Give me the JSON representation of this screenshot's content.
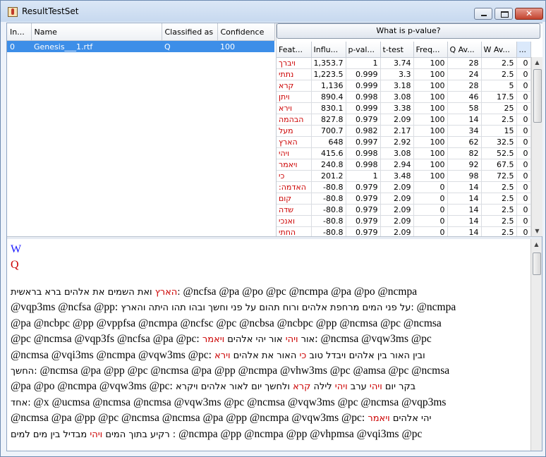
{
  "window": {
    "title": "ResultTestSet"
  },
  "results_table": {
    "columns": [
      "In...",
      "Name",
      "Classified as",
      "Confidence"
    ],
    "rows": [
      {
        "index": "0",
        "name": "Genesis___1.rtf",
        "class": "Q",
        "confidence": "100"
      }
    ]
  },
  "pvalue_button": "What is p-value?",
  "feature_table": {
    "columns": [
      "Feat...",
      "Influ...",
      "p-val...",
      "t-test",
      "Freq...",
      "Q Av...",
      "W Av...",
      "..."
    ],
    "rows": [
      [
        "ויברך",
        "1,353.7",
        "1",
        "3.74",
        "100",
        "28",
        "2.5",
        "0"
      ],
      [
        "נתתי",
        "1,223.5",
        "0.999",
        "3.3",
        "100",
        "24",
        "2.5",
        "0"
      ],
      [
        "קרא",
        "1,136",
        "0.999",
        "3.18",
        "100",
        "28",
        "5",
        "0"
      ],
      [
        "ויתן",
        "890.4",
        "0.998",
        "3.08",
        "100",
        "46",
        "17.5",
        "0"
      ],
      [
        "וירא",
        "830.1",
        "0.999",
        "3.38",
        "100",
        "58",
        "25",
        "0"
      ],
      [
        "הבהמה",
        "827.8",
        "0.979",
        "2.09",
        "100",
        "14",
        "2.5",
        "0"
      ],
      [
        "מעל",
        "700.7",
        "0.982",
        "2.17",
        "100",
        "34",
        "15",
        "0"
      ],
      [
        "הארץ",
        "648",
        "0.997",
        "2.92",
        "100",
        "62",
        "32.5",
        "0"
      ],
      [
        "ויהי",
        "415.6",
        "0.998",
        "3.08",
        "100",
        "82",
        "52.5",
        "0"
      ],
      [
        "ויאמר",
        "240.8",
        "0.998",
        "2.94",
        "100",
        "92",
        "67.5",
        "0"
      ],
      [
        "כי",
        "201.2",
        "1",
        "3.48",
        "100",
        "98",
        "72.5",
        "0"
      ],
      [
        "האדמה:",
        "-80.8",
        "0.979",
        "2.09",
        "0",
        "14",
        "2.5",
        "0"
      ],
      [
        "קום",
        "-80.8",
        "0.979",
        "2.09",
        "0",
        "14",
        "2.5",
        "0"
      ],
      [
        "שדה",
        "-80.8",
        "0.979",
        "2.09",
        "0",
        "14",
        "2.5",
        "0"
      ],
      [
        "ואנכי",
        "-80.8",
        "0.979",
        "2.09",
        "0",
        "14",
        "2.5",
        "0"
      ],
      [
        "החתי",
        "-80.8",
        "0.979",
        "2.09",
        "0",
        "14",
        "2.5",
        "0"
      ]
    ]
  },
  "text_pane": {
    "class_w": "W",
    "class_q": "Q",
    "lines": [
      [
        [
          "r",
          "הארץ"
        ],
        [
          "k",
          " ואת השמים את אלהים ברא בראשית:"
        ],
        [
          "k",
          " @ncfsa @pa @po @pc @ncmpa @pa @po @ncmpa"
        ]
      ],
      [
        [
          "k",
          "@vqp3ms @ncfsa @pp:"
        ],
        [
          "k",
          " על פני המים מרחפת אלהים ורוח תהום על פני וחשך ובהו תהו היתה והארץ:"
        ],
        [
          "k",
          " @ncmpa"
        ]
      ],
      [
        [
          "k",
          "@pa @ncbpc @pp @vppfsa @ncmpa @ncfsc @pc @ncbsa @ncbpc @pp @ncmsa @pc @ncmsa"
        ]
      ],
      [
        [
          "k",
          "@pc @ncmsa @vqp3fs @ncfsa @pa @pc:"
        ],
        [
          "k",
          "  אור "
        ],
        [
          "r",
          "ויהי"
        ],
        [
          "k",
          " אור יהי אלהים "
        ],
        [
          "r",
          "ויאמר"
        ],
        [
          "k",
          ":"
        ],
        [
          "k",
          " @ncmsa @vqw3ms @pc"
        ]
      ],
      [
        [
          "k",
          "@ncmsa @vqi3ms @ncmpa @vqw3ms @pc:"
        ],
        [
          "k",
          " ובין האור בין אלהים ויבדל טוב "
        ],
        [
          "r",
          "כי"
        ],
        [
          "k",
          " האור את אלהים "
        ],
        [
          "r",
          "וירא"
        ]
      ],
      [
        [
          "k",
          "החשך:"
        ],
        [
          "k",
          " @ncmsa @pa @pp @pc @ncmsa @pa @pp @ncmpa @vhw3ms @pc @amsa @pc @ncmsa"
        ]
      ],
      [
        [
          "k",
          "@pa @po @ncmpa @vqw3ms @pc:"
        ],
        [
          "k",
          "  בקר יום "
        ],
        [
          "r",
          "ויהי"
        ],
        [
          "k",
          " ערב "
        ],
        [
          "r",
          "ויהי"
        ],
        [
          "k",
          " לילה "
        ],
        [
          "r",
          "קרא"
        ],
        [
          "k",
          " ולחשך יום לאור אלהים ויקרא"
        ]
      ],
      [
        [
          "k",
          "אחד:"
        ],
        [
          "k",
          " @x @ucmsa @ncmsa @ncmsa @vqw3ms @pc @ncmsa @vqw3ms @pc @ncmsa @vqp3ms"
        ]
      ],
      [
        [
          "k",
          "@ncmsa @pa @pp @pc @ncmsa @ncmsa @pa @pp @ncmpa @vqw3ms @pc:"
        ],
        [
          "k",
          "  יהי אלהים "
        ],
        [
          "r",
          "ויאמר"
        ]
      ],
      [
        [
          "k",
          "רקיע בתוך המים "
        ],
        [
          "r",
          "ויהי"
        ],
        [
          "k",
          " מבדיל בין מים למים :"
        ],
        [
          "k",
          " @ncmpa @pp @ncmpa @pp @vhpmsa @vqi3ms @pc"
        ]
      ]
    ]
  }
}
